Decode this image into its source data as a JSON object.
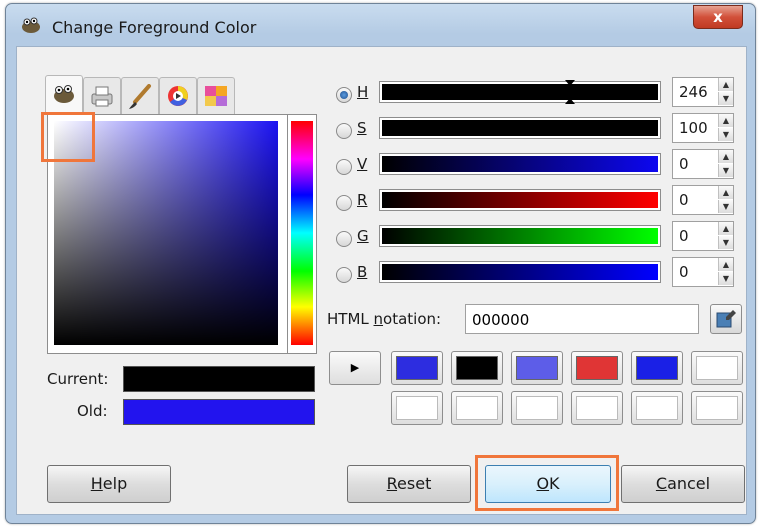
{
  "window": {
    "title": "Change Foreground Color",
    "close_label": "x"
  },
  "tabs": [
    {
      "name": "gimp-selector-icon"
    },
    {
      "name": "cmyk-printer-icon"
    },
    {
      "name": "watercolor-brush-icon"
    },
    {
      "name": "color-wheel-icon"
    },
    {
      "name": "palette-scales-icon"
    }
  ],
  "current_label": "Current:",
  "old_label": "Old:",
  "colors": {
    "current": "#000000",
    "old": "#2214ee"
  },
  "channels": [
    {
      "key": "H",
      "value": "246",
      "selected": true
    },
    {
      "key": "S",
      "value": "100",
      "selected": false
    },
    {
      "key": "V",
      "value": "0",
      "selected": false
    },
    {
      "key": "R",
      "value": "0",
      "selected": false
    },
    {
      "key": "G",
      "value": "0",
      "selected": false
    },
    {
      "key": "B",
      "value": "0",
      "selected": false
    }
  ],
  "html_notation": {
    "label_prefix": "HTML ",
    "label_u": "n",
    "label_suffix": "otation:",
    "value": "000000"
  },
  "history": [
    "#2d2de0",
    "#000000",
    "#5d5de8",
    "#e03535",
    "#1a20e6",
    "#ffffff",
    "#ffffff",
    "#ffffff",
    "#ffffff",
    "#ffffff",
    "#ffffff",
    "#ffffff"
  ],
  "buttons": {
    "help_u": "H",
    "help_rest": "elp",
    "reset_u": "R",
    "reset_rest": "eset",
    "ok_u": "O",
    "ok_rest": "K",
    "cancel_u": "C",
    "cancel_rest": "ancel"
  }
}
